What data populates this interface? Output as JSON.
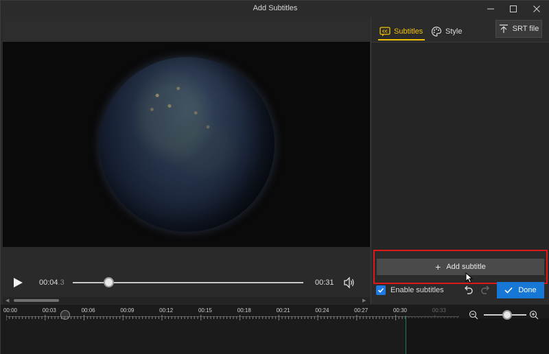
{
  "window": {
    "title": "Add Subtitles"
  },
  "player": {
    "current_time_main": "00:04",
    "current_time_fraction": ".3",
    "duration": "00:31",
    "progress_fraction": 0.14
  },
  "panel": {
    "tabs": [
      {
        "label": "Subtitles",
        "icon": "cc-icon",
        "active": true
      },
      {
        "label": "Style",
        "icon": "palette-icon",
        "active": false
      }
    ],
    "srt_label": "SRT file",
    "add_subtitle_label": "Add subtitle",
    "enable_label": "Enable subtitles",
    "enable_checked": true,
    "done_label": "Done"
  },
  "timeline": {
    "ticks": [
      "00:00",
      "00:03",
      "00:06",
      "00:09",
      "00:12",
      "00:15",
      "00:18",
      "00:21",
      "00:24",
      "00:27",
      "00:30",
      "00:33"
    ],
    "dim_ticks": [
      "00:33"
    ]
  },
  "colors": {
    "accent": "#f2c200",
    "primary": "#1677d6",
    "highlight": "#e01818"
  }
}
